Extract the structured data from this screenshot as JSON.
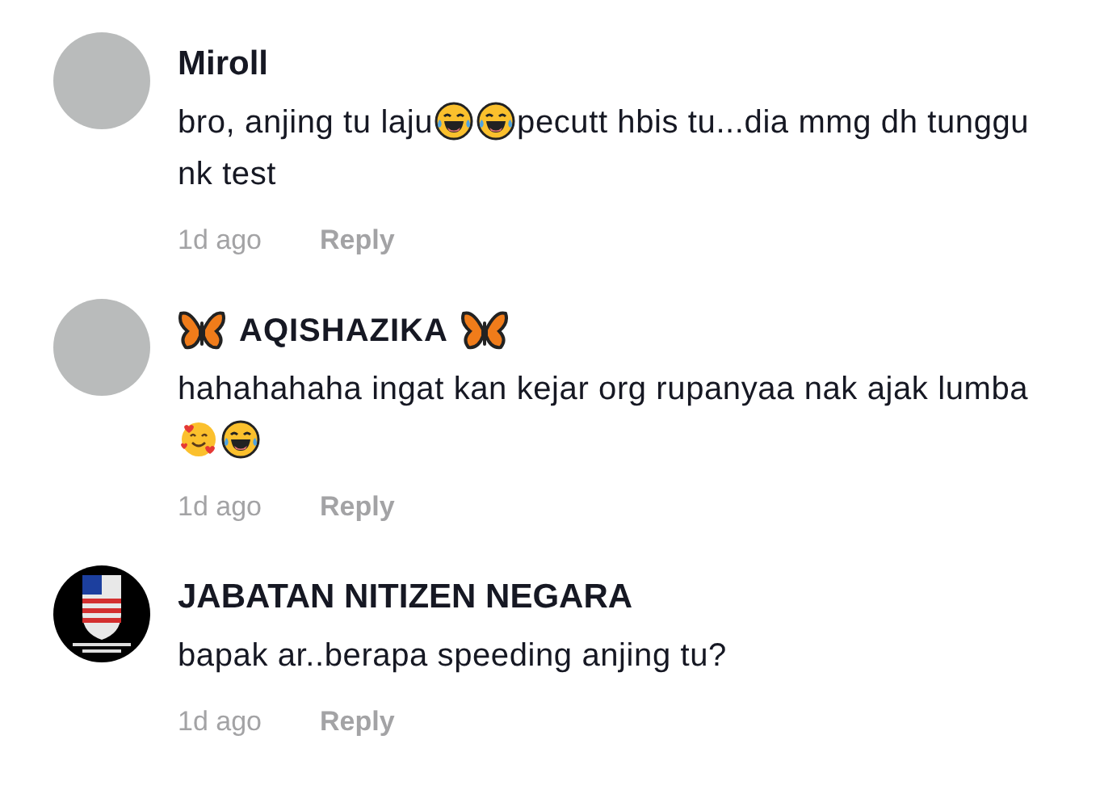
{
  "comments": [
    {
      "avatar": {
        "kind": "photo"
      },
      "name": [
        {
          "kind": "text",
          "text": "Miroll"
        }
      ],
      "body": [
        {
          "kind": "text",
          "text": "bro, anjing tu laju"
        },
        {
          "kind": "laugh"
        },
        {
          "kind": "laugh"
        },
        {
          "kind": "text",
          "text": "pecutt hbis tu...dia mmg dh tunggu nk test"
        }
      ],
      "time": "1d ago",
      "reply": "Reply"
    },
    {
      "avatar": {
        "kind": "photo"
      },
      "name": [
        {
          "kind": "butterfly"
        },
        {
          "kind": "text",
          "text": "AQISHAZIKA"
        },
        {
          "kind": "butterfly"
        }
      ],
      "body": [
        {
          "kind": "text",
          "text": "hahahahaha ingat kan kejar org rupanyaa nak ajak lumba "
        },
        {
          "kind": "hearts"
        },
        {
          "kind": "laugh"
        }
      ],
      "time": "1d ago",
      "reply": "Reply"
    },
    {
      "avatar": {
        "kind": "logo"
      },
      "name": [
        {
          "kind": "text",
          "text": "JABATAN NITIZEN NEGARA"
        }
      ],
      "body": [
        {
          "kind": "text",
          "text": "bapak ar..berapa speeding anjing tu?"
        }
      ],
      "time": "1d ago",
      "reply": "Reply"
    }
  ]
}
